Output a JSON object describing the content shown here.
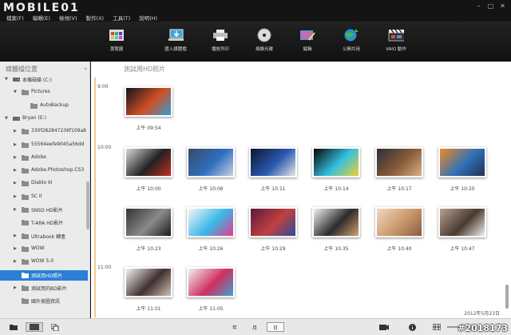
{
  "app": {
    "logo": "MOBILE01"
  },
  "menu": [
    "檔案(F)",
    "編輯(E)",
    "檢視(V)",
    "製作(X)",
    "工具(T)",
    "說明(H)"
  ],
  "window_controls": [
    "–",
    "□",
    "✕"
  ],
  "toolbar": [
    {
      "label": "瀏覽器",
      "icon": "browser-icon"
    },
    {
      "label": "匯入媒體檔",
      "icon": "import-icon"
    },
    {
      "label": "播放列印",
      "icon": "print-icon"
    },
    {
      "label": "燒錄光碟",
      "icon": "disc-icon"
    },
    {
      "label": "編輯",
      "icon": "edit-icon"
    },
    {
      "label": "公開共用",
      "icon": "share-icon"
    },
    {
      "label": "VAIO 動作",
      "icon": "movie-icon"
    }
  ],
  "sidebar": {
    "title": "媒體檔位置",
    "collapse": "«",
    "items": [
      {
        "label": "本機磁碟 (C:)",
        "level": 0,
        "arrow": "▼",
        "type": "drive"
      },
      {
        "label": "Pictures",
        "level": 1,
        "arrow": "▼",
        "type": "folder"
      },
      {
        "label": "AutoBackup",
        "level": 2,
        "arrow": "",
        "type": "folder"
      },
      {
        "label": "Bryan (E:)",
        "level": 0,
        "arrow": "▼",
        "type": "drive"
      },
      {
        "label": "330f282847236f109a8",
        "level": 1,
        "arrow": "▶",
        "type": "folder"
      },
      {
        "label": "55564eefe9045a56dd",
        "level": 1,
        "arrow": "▶",
        "type": "folder"
      },
      {
        "label": "Adobe",
        "level": 1,
        "arrow": "▶",
        "type": "folder"
      },
      {
        "label": "Adobe.Photoshop.CS3",
        "level": 1,
        "arrow": "▶",
        "type": "folder"
      },
      {
        "label": "Diablo III",
        "level": 1,
        "arrow": "▶",
        "type": "folder"
      },
      {
        "label": "SC II",
        "level": 1,
        "arrow": "▶",
        "type": "folder"
      },
      {
        "label": "SNSD HD影片",
        "level": 1,
        "arrow": "▶",
        "type": "folder"
      },
      {
        "label": "T-ARA HD影片",
        "level": 1,
        "arrow": "",
        "type": "folder"
      },
      {
        "label": "Ultrabook 轉盒",
        "level": 1,
        "arrow": "▶",
        "type": "folder"
      },
      {
        "label": "WOW",
        "level": 1,
        "arrow": "▶",
        "type": "folder"
      },
      {
        "label": "WOW 5.0",
        "level": 1,
        "arrow": "▶",
        "type": "folder"
      },
      {
        "label": "測試用HD照片",
        "level": 1,
        "arrow": "",
        "type": "folder",
        "selected": true
      },
      {
        "label": "測試用的BD影片",
        "level": 1,
        "arrow": "▶",
        "type": "folder"
      },
      {
        "label": "國外美圖資訊",
        "level": 1,
        "arrow": "",
        "type": "folder"
      }
    ]
  },
  "main": {
    "title": "測試用HD照片",
    "date": "2012年5月23日",
    "groups": [
      {
        "hour": "9:00",
        "photos": [
          {
            "time": "上午 09:54",
            "colors": [
              "#10131e",
              "#d04f22",
              "#2f9fd6"
            ]
          }
        ]
      },
      {
        "hour": "10:00",
        "photos": [
          {
            "time": "上午 10:00",
            "colors": [
              "#d8d8d8",
              "#222222",
              "#c03020"
            ]
          },
          {
            "time": "上午 10:06",
            "colors": [
              "#3a4a63",
              "#2f6fc0",
              "#c7d2de"
            ]
          },
          {
            "time": "上午 10:11",
            "colors": [
              "#0d1730",
              "#2a58b0",
              "#e6e6e6"
            ]
          },
          {
            "time": "上午 10:14",
            "colors": [
              "#050505",
              "#35c0e0",
              "#f0d030"
            ]
          },
          {
            "time": "上午 10:17",
            "colors": [
              "#2a2f3a",
              "#8a5c3a",
              "#d9b089"
            ]
          },
          {
            "time": "上午 10:20",
            "colors": [
              "#f08a20",
              "#3270b8",
              "#1f3050"
            ]
          },
          {
            "time": "上午 10:23",
            "colors": [
              "#333333",
              "#8a8a8a",
              "#1a1a1a"
            ]
          },
          {
            "time": "上午 10:26",
            "colors": [
              "#f5f5f5",
              "#38b8e8",
              "#e83a8a"
            ]
          },
          {
            "time": "上午 10:29",
            "colors": [
              "#5b1a3a",
              "#c04040",
              "#2a4a9a"
            ]
          },
          {
            "time": "上午 10:35",
            "colors": [
              "#f2f2f2",
              "#2b2b2b",
              "#d4a070"
            ]
          },
          {
            "time": "上午 10:40",
            "colors": [
              "#f0d8c0",
              "#c8986a",
              "#8a5a40"
            ]
          },
          {
            "time": "上午 10:47",
            "colors": [
              "#b8a090",
              "#4a3a30",
              "#f0f0f0"
            ]
          }
        ]
      },
      {
        "hour": "11:00",
        "photos": [
          {
            "time": "上午 11:01",
            "colors": [
              "#f2f2f2",
              "#403030",
              "#d0c0b0"
            ]
          },
          {
            "time": "上午 11:05",
            "colors": [
              "#f0f0f0",
              "#d03060",
              "#40a0d0"
            ]
          }
        ]
      }
    ]
  },
  "statusbar": {
    "views": [
      "年",
      "月",
      "日"
    ],
    "selected_view": "日"
  },
  "watermark": "#2018173"
}
